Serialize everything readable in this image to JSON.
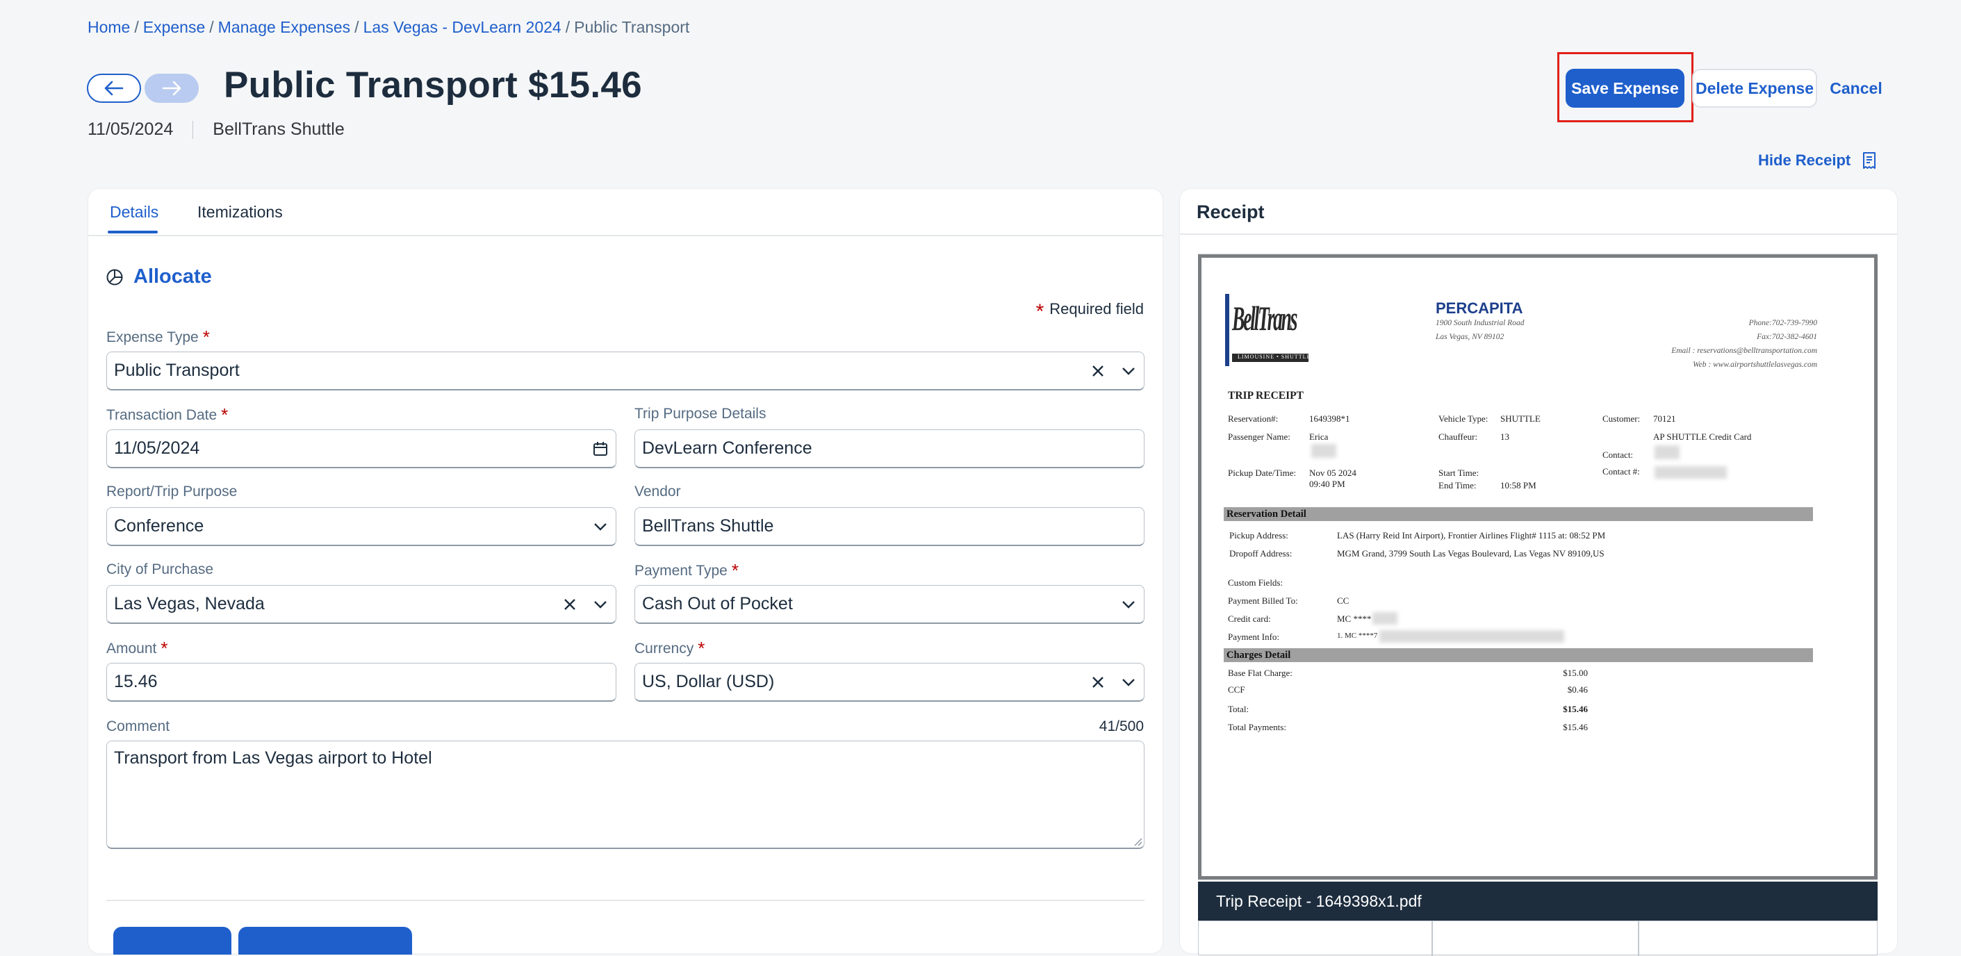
{
  "breadcrumb": {
    "items": [
      "Home",
      "Expense",
      "Manage Expenses",
      "Las Vegas - DevLearn 2024",
      "Public Transport"
    ],
    "separator": "/"
  },
  "header": {
    "title": "Public Transport $15.46",
    "date": "11/05/2024",
    "vendor": "BellTrans Shuttle",
    "save_label": "Save Expense",
    "delete_label": "Delete Expense",
    "cancel_label": "Cancel",
    "hide_receipt_label": "Hide Receipt"
  },
  "tabs": [
    {
      "label": "Details",
      "active": true
    },
    {
      "label": "Itemizations",
      "active": false
    }
  ],
  "form": {
    "allocate_label": "Allocate",
    "required_note": "Required field",
    "expense_type": {
      "label": "Expense Type",
      "value": "Public Transport"
    },
    "transaction_date": {
      "label": "Transaction Date",
      "value": "11/05/2024"
    },
    "trip_purpose_details": {
      "label": "Trip Purpose Details",
      "value": "DevLearn Conference"
    },
    "report_trip_purpose": {
      "label": "Report/Trip Purpose",
      "value": "Conference"
    },
    "vendor": {
      "label": "Vendor",
      "value": "BellTrans Shuttle"
    },
    "city_of_purchase": {
      "label": "City of Purchase",
      "value": "Las Vegas, Nevada"
    },
    "payment_type": {
      "label": "Payment Type",
      "value": "Cash Out of Pocket"
    },
    "amount": {
      "label": "Amount",
      "value": "15.46"
    },
    "currency": {
      "label": "Currency",
      "value": "US, Dollar (USD)"
    },
    "comment": {
      "label": "Comment",
      "value": "Transport from Las Vegas airport to Hotel",
      "counter": "41/500"
    }
  },
  "receipt": {
    "heading": "Receipt",
    "caption": "Trip Receipt - 1649398x1.pdf",
    "doc": {
      "logo_text": "BellTrans",
      "logo_sub": "LIMOUSINE • SHUTTLE",
      "company": "PERCAPITA",
      "address1": "1900 South Industrial Road",
      "address2": "Las Vegas, NV  89102",
      "phone": "Phone:702-739-7990",
      "fax": "Fax:702-382-4601",
      "email": "Email : reservations@belltransportation.com",
      "web": "Web : www.airportshuttlelasvegas.com",
      "trip_receipt": "TRIP RECEIPT",
      "reservation_label": "Reservation#:",
      "reservation_value": "1649398*1",
      "vehicle_label": "Vehicle Type:",
      "vehicle_value": "SHUTTLE",
      "customer_label": "Customer:",
      "customer_value": "70121",
      "passenger_label": "Passenger Name:",
      "passenger_value": "Erica",
      "chauffeur_label": "Chauffeur:",
      "chauffeur_value": "13",
      "customer_sub": "AP SHUTTLE Credit Card",
      "contact_label": "Contact:",
      "pickup_dt_label": "Pickup Date/Time:",
      "pickup_date": "Nov 05 2024",
      "pickup_time": "09:40 PM",
      "start_label": "Start Time:",
      "end_label": "End Time:",
      "end_value": "10:58 PM",
      "contact_no_label": "Contact #:",
      "reservation_detail": "Reservation Detail",
      "pickup_addr_label": "Pickup Address:",
      "pickup_addr_value": "LAS (Harry Reid Int Airport), Frontier Airlines Flight# 1115  at: 08:52 PM",
      "dropoff_label": "Dropoff Address:",
      "dropoff_value": "MGM Grand, 3799 South Las Vegas Boulevard, Las Vegas NV 89109,US",
      "custom_fields": "Custom Fields:",
      "billed_label": "Payment Billed To:",
      "billed_value": "CC",
      "card_label": "Credit card:",
      "card_value": "MC ****",
      "payinfo_label": "Payment Info:",
      "payinfo_value": "1. MC ****7",
      "charges_detail": "Charges Detail",
      "base_label": "Base Flat Charge:",
      "base_value": "$15.00",
      "ccf_label": "CCF",
      "ccf_value": "$0.46",
      "total_label": "Total:",
      "total_value": "$15.46",
      "payments_label": "Total Payments:",
      "payments_value": "$15.46"
    }
  },
  "colors": {
    "accent": "#1f5fcc",
    "required": "#bb0000",
    "highlight": "#e0201a",
    "caption_bg": "#1d2d3e"
  }
}
